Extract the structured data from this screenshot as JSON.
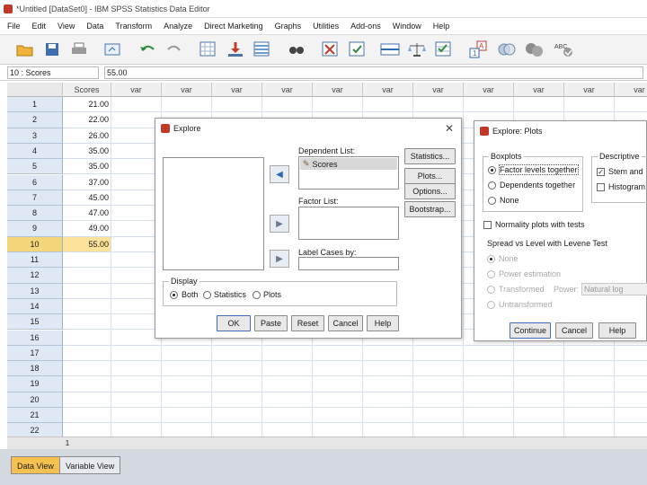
{
  "window": {
    "title": "*Untitled [DataSet0] - IBM SPSS Statistics Data Editor"
  },
  "menu": [
    "File",
    "Edit",
    "View",
    "Data",
    "Transform",
    "Analyze",
    "Direct Marketing",
    "Graphs",
    "Utilities",
    "Add-ons",
    "Window",
    "Help"
  ],
  "toolbar_icons": [
    "open-icon",
    "save-icon",
    "print-icon",
    "dialog-recall-icon",
    "undo-icon",
    "redo-icon",
    "goto-case-icon",
    "goto-variable-icon",
    "variables-icon",
    "find-icon",
    "insert-cases-icon",
    "insert-variable-icon",
    "split-file-icon",
    "weight-cases-icon",
    "select-cases-icon",
    "value-labels-icon",
    "use-sets-icon",
    "spell-check-icon"
  ],
  "cell_editor": {
    "ref": "10 : Scores",
    "value": "55.00"
  },
  "grid": {
    "columns": [
      "Scores",
      "var",
      "var",
      "var",
      "var",
      "var",
      "var",
      "var",
      "var",
      "var",
      "var",
      "var"
    ],
    "rows": [
      "1",
      "2",
      "3",
      "4",
      "5",
      "6",
      "7",
      "8",
      "9",
      "10",
      "11",
      "12",
      "13",
      "14",
      "15",
      "16",
      "17",
      "18",
      "19",
      "20",
      "21",
      "22"
    ],
    "scores": [
      "21.00",
      "22.00",
      "26.00",
      "35.00",
      "35.00",
      "37.00",
      "45.00",
      "47.00",
      "49.00",
      "55.00"
    ],
    "selected_row": "10",
    "hscroll_marker": "1"
  },
  "tabs": {
    "data_view": "Data View",
    "variable_view": "Variable View"
  },
  "explore": {
    "title": "Explore",
    "dependent_list_label": "Dependent List:",
    "dependent_items": [
      "Scores"
    ],
    "factor_list_label": "Factor List:",
    "label_cases_label": "Label Cases by:",
    "side_buttons": [
      "Statistics...",
      "Plots...",
      "Options...",
      "Bootstrap..."
    ],
    "display_label": "Display",
    "display_options": [
      "Both",
      "Statistics",
      "Plots"
    ],
    "display_selected": "Both",
    "bottom_buttons": [
      "OK",
      "Paste",
      "Reset",
      "Cancel",
      "Help"
    ]
  },
  "plots": {
    "title": "Explore: Plots",
    "boxplots_label": "Boxplots",
    "boxplot_options": [
      "Factor levels together",
      "Dependents together",
      "None"
    ],
    "boxplot_selected": "Factor levels together",
    "descriptive_label": "Descriptive",
    "descriptive_options": [
      "Stem and",
      "Histogram"
    ],
    "descriptive_checked": [
      "Stem and"
    ],
    "normality_label": "Normality plots with tests",
    "spread_label": "Spread vs Level with Levene Test",
    "spread_options": [
      "None",
      "Power estimation",
      "Transformed",
      "Untransformed"
    ],
    "power_label": "Power:",
    "power_value": "Natural log",
    "buttons": [
      "Continue",
      "Cancel",
      "Help"
    ]
  }
}
